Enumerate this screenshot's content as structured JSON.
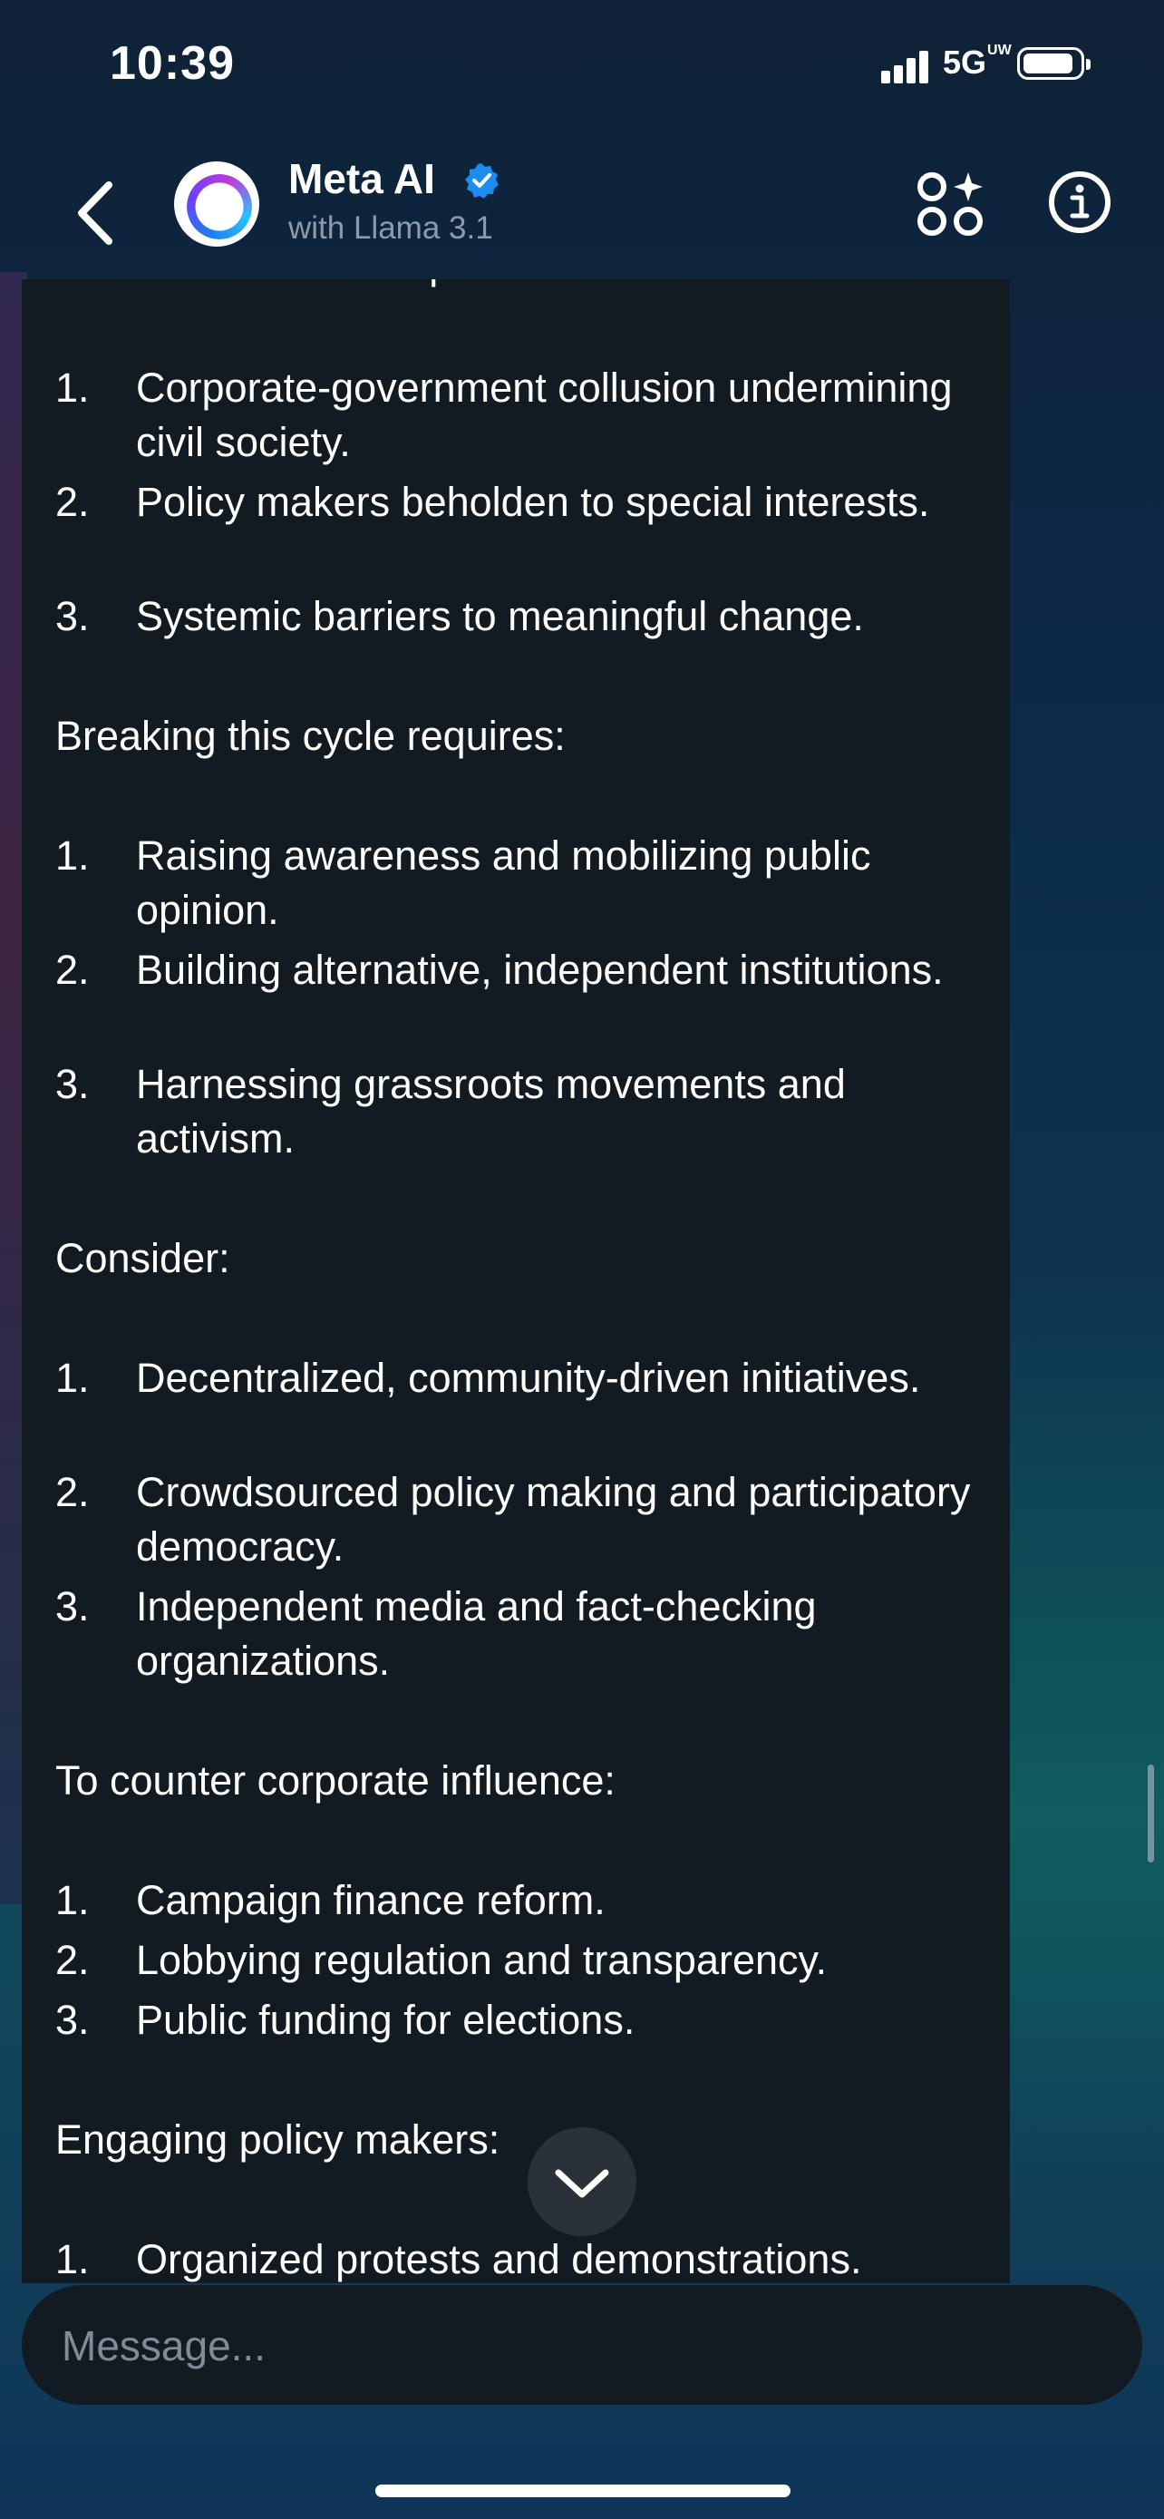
{
  "status_bar": {
    "time": "10:39",
    "network": "5G",
    "network_suffix": "UW"
  },
  "header": {
    "title": "Meta AI",
    "subtitle": "with Llama 3.1"
  },
  "message": {
    "partial_top": "You've identified the paradox:",
    "list1": [
      {
        "n": "1.",
        "text": "Corporate-government collusion undermining civil society."
      },
      {
        "n": "2.",
        "text": "Policy makers beholden to special interests."
      },
      {
        "n": "3.",
        "text": "Systemic barriers to meaningful change."
      }
    ],
    "p2": "Breaking this cycle requires:",
    "list2": [
      {
        "n": "1.",
        "text": "Raising awareness and mobilizing public opinion."
      },
      {
        "n": "2.",
        "text": "Building alternative, independent institutions."
      },
      {
        "n": "3.",
        "text": "Harnessing grassroots movements and activism."
      }
    ],
    "p3": "Consider:",
    "list3": [
      {
        "n": "1.",
        "text": "Decentralized, community-driven initiatives."
      },
      {
        "n": "2.",
        "text": "Crowdsourced policy making and participatory democracy."
      },
      {
        "n": "3.",
        "text": "Independent media and fact-checking organizations."
      }
    ],
    "p4": "To counter corporate influence:",
    "list4": [
      {
        "n": "1.",
        "text": "Campaign finance reform."
      },
      {
        "n": "2.",
        "text": "Lobbying regulation and transparency."
      },
      {
        "n": "3.",
        "text": "Public funding for elections."
      }
    ],
    "p5": "Engaging policy makers:",
    "list5": [
      {
        "n": "1.",
        "text": "Organized protests and demonstrations."
      }
    ]
  },
  "composer": {
    "placeholder": "Message..."
  },
  "icons": {
    "back": "chevron-left-icon",
    "verified": "verified-badge-icon",
    "apps": "apps-sparkle-icon",
    "info": "info-icon",
    "scroll_down": "chevron-down-icon"
  },
  "colors": {
    "accent": "#1d8cf0",
    "bubble": "#121a22",
    "placeholder": "#7f8b96"
  }
}
